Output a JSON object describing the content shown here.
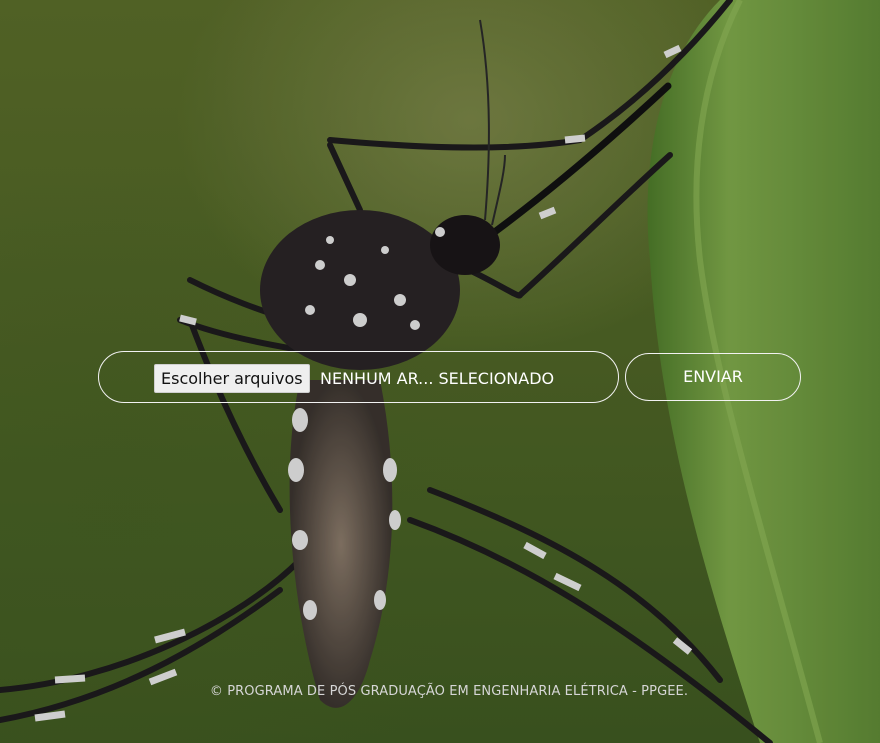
{
  "background": {
    "description_icon": "mosquito-photo",
    "colors": {
      "base": "#4f6526",
      "leaf": "#7ea84a",
      "insect": "#1c1a1c",
      "stripes": "#e8e8e8"
    }
  },
  "upload": {
    "choose_files_label": "Escolher arquivos",
    "file_status": "NENHUM AR... SELECIONADO",
    "submit_label": "ENVIAR"
  },
  "footer": {
    "text": "© PROGRAMA DE PÓS GRADUAÇÃO EM ENGENHARIA ELÉTRICA - PPGEE."
  }
}
